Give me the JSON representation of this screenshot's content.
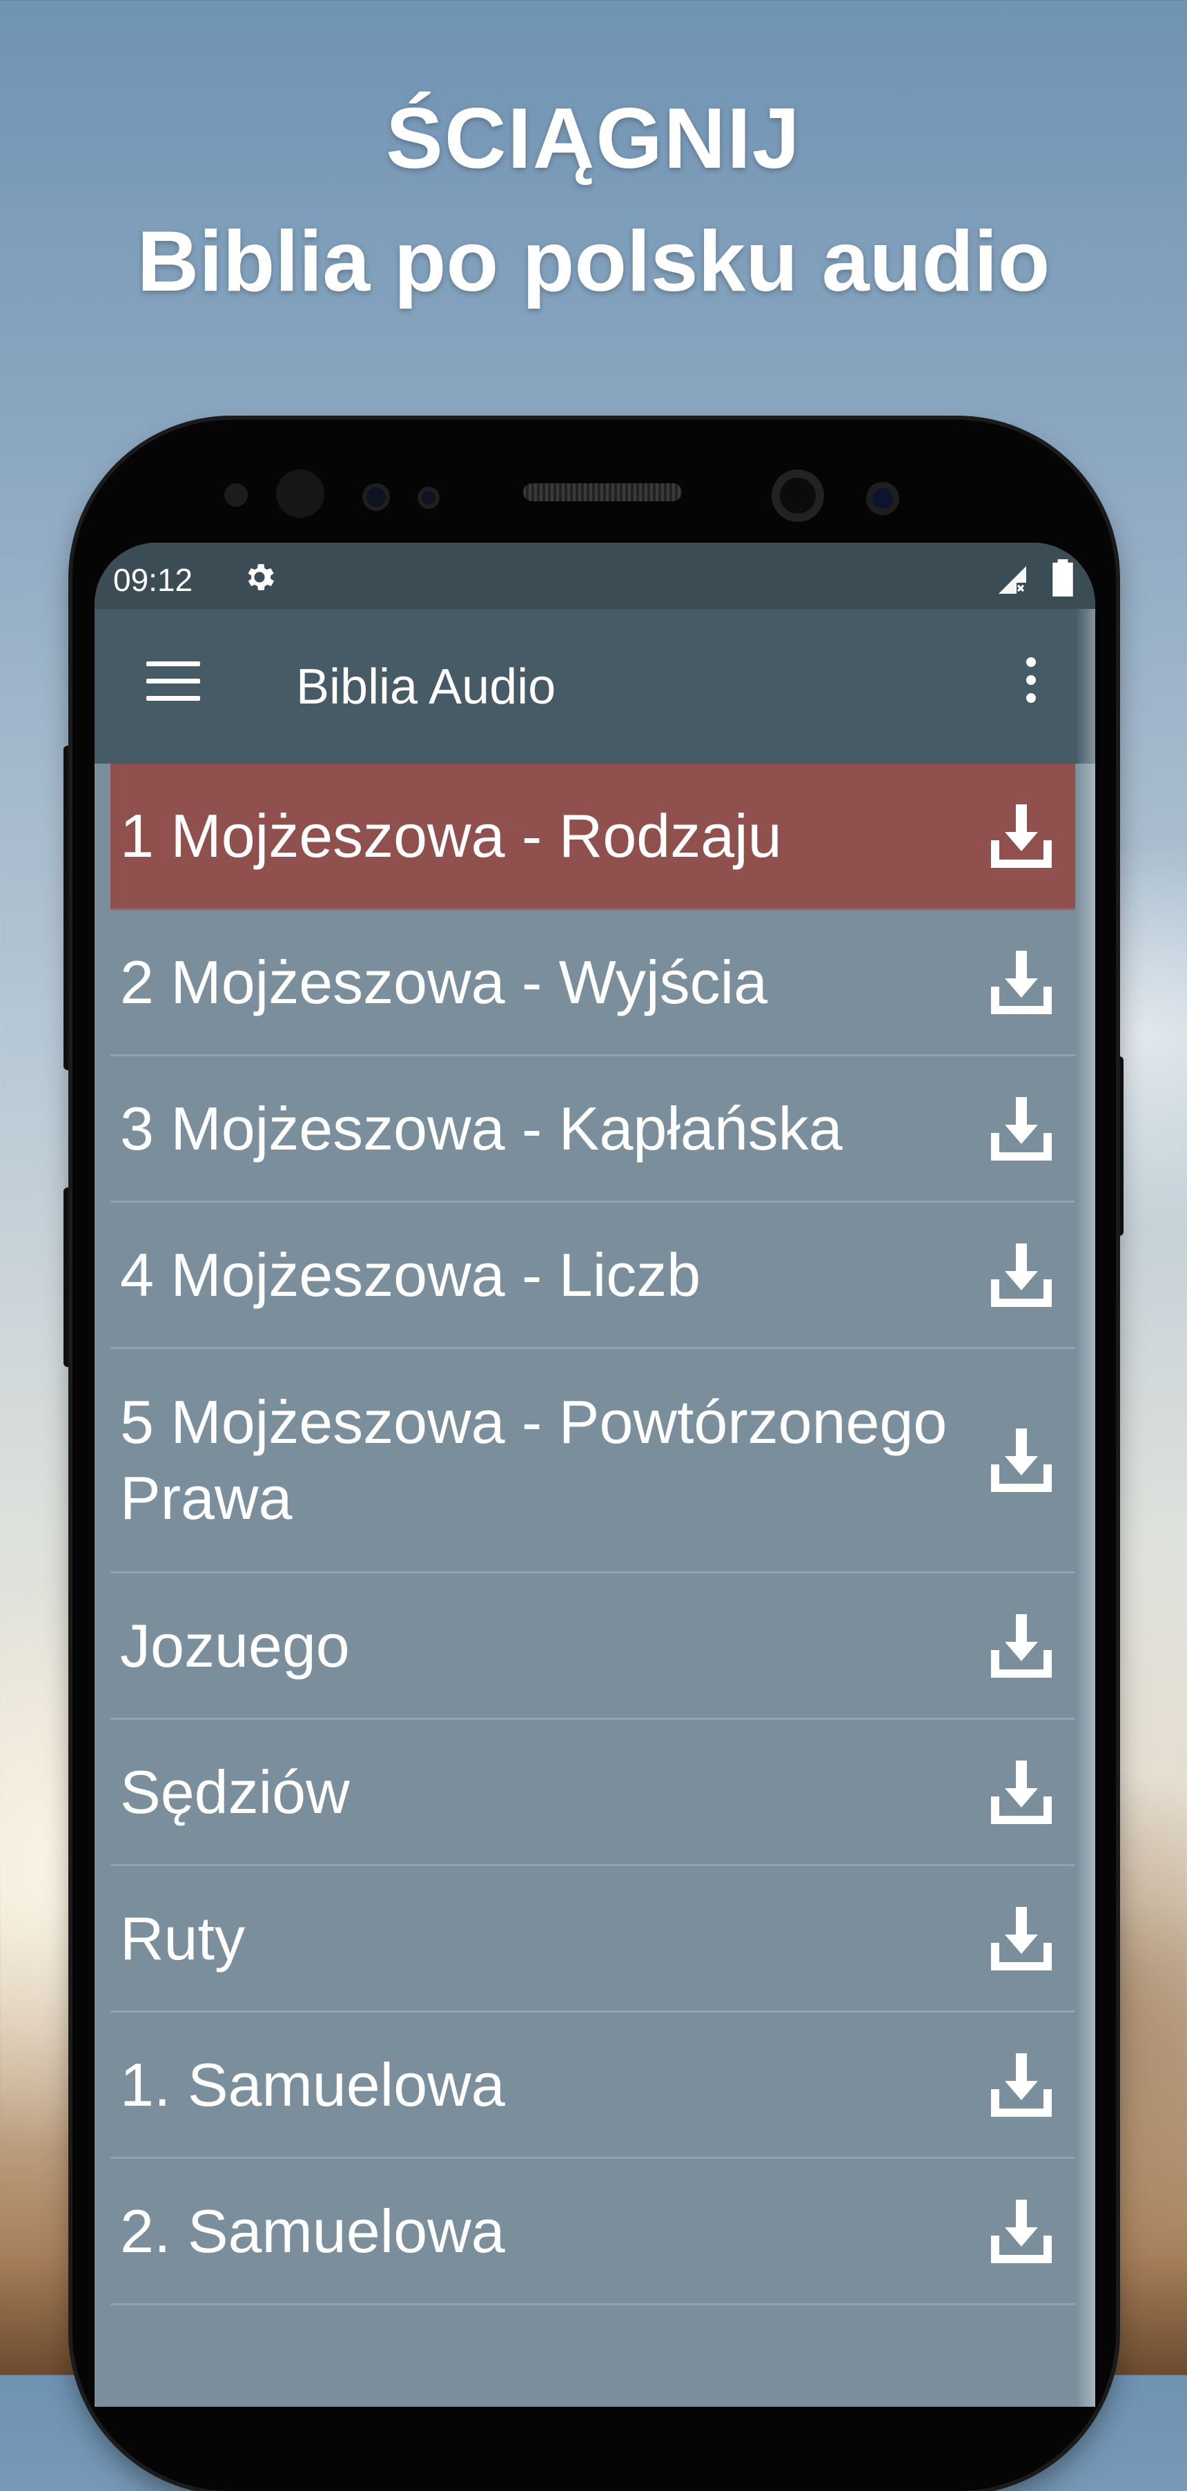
{
  "promo": {
    "line1": "ŚCIĄGNIJ",
    "line2": "Biblia po polsku audio"
  },
  "status_bar": {
    "time": "09:12",
    "icons": [
      "gear-icon",
      "signal-icon",
      "battery-icon"
    ]
  },
  "app_bar": {
    "title": "Biblia Audio",
    "menu_icon": "menu-icon",
    "overflow_icon": "more-vert-icon"
  },
  "colors": {
    "status_bar": "#3c4c55",
    "app_bar": "#475b67",
    "list_background": "#7a8f9b",
    "selected_row": "#8f504e"
  },
  "books": [
    {
      "label": "1 Mojżeszowa - Rodzaju",
      "selected": true,
      "icon": "download-icon"
    },
    {
      "label": "2 Mojżeszowa - Wyjścia",
      "selected": false,
      "icon": "download-icon"
    },
    {
      "label": "3 Mojżeszowa - Kapłańska",
      "selected": false,
      "icon": "download-icon"
    },
    {
      "label": "4 Mojżeszowa - Liczb",
      "selected": false,
      "icon": "download-icon"
    },
    {
      "label": "5 Mojżeszowa - Powtórzonego Prawa",
      "selected": false,
      "icon": "download-icon"
    },
    {
      "label": "Jozuego",
      "selected": false,
      "icon": "download-icon"
    },
    {
      "label": "Sędziów",
      "selected": false,
      "icon": "download-icon"
    },
    {
      "label": "Ruty",
      "selected": false,
      "icon": "download-icon"
    },
    {
      "label": "1. Samuelowa",
      "selected": false,
      "icon": "download-icon"
    },
    {
      "label": "2. Samuelowa",
      "selected": false,
      "icon": "download-icon"
    }
  ]
}
